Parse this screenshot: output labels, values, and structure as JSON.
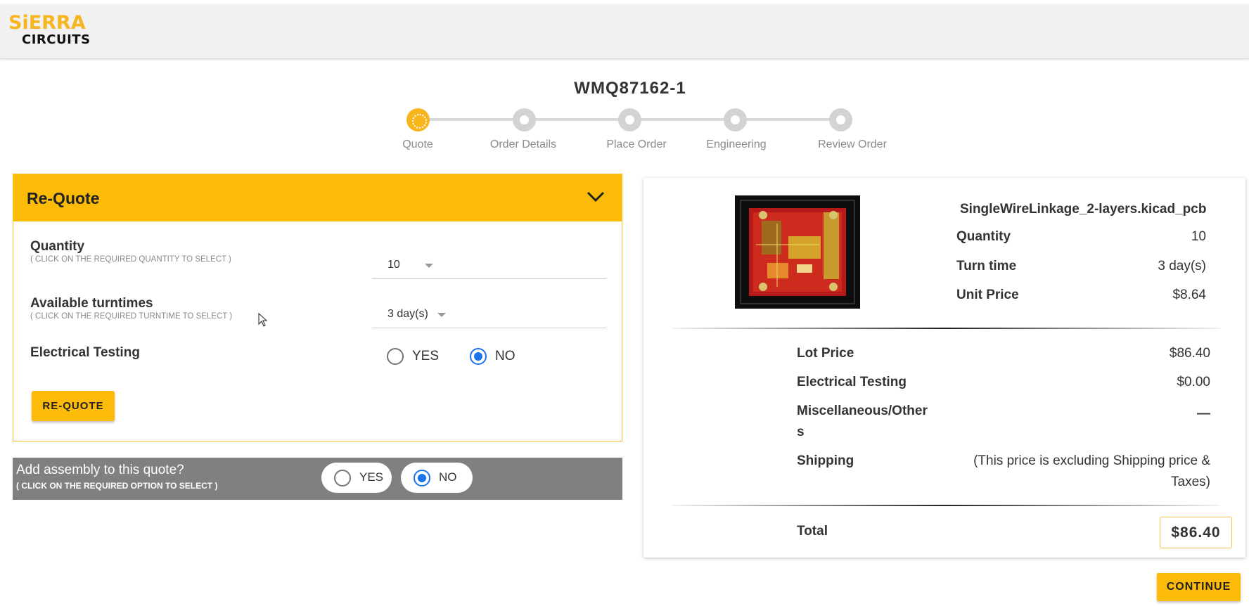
{
  "header": {
    "logo_top": "SiERRA",
    "logo_bottom": "CIRCUITS"
  },
  "order_id": "WMQ87162-1",
  "steps": [
    {
      "label": "Quote",
      "active": true
    },
    {
      "label": "Order Details",
      "active": false
    },
    {
      "label": "Place Order",
      "active": false
    },
    {
      "label": "Engineering",
      "active": false
    },
    {
      "label": "Review Order",
      "active": false
    }
  ],
  "requote": {
    "title": "Re-Quote",
    "quantity_label": "Quantity",
    "quantity_hint": "( CLICK ON THE REQUIRED QUANTITY TO SELECT )",
    "quantity_value": "10",
    "turntime_label": "Available turntimes",
    "turntime_hint": "( CLICK ON THE REQUIRED TURNTIME TO SELECT )",
    "turntime_value": "3 day(s)",
    "etest_label": "Electrical Testing",
    "etest_yes": "YES",
    "etest_no": "NO",
    "etest_selected": "NO",
    "button_label": "RE-QUOTE"
  },
  "assembly": {
    "question": "Add assembly to this quote?",
    "hint": "( CLICK ON THE REQUIRED OPTION TO SELECT )",
    "yes": "YES",
    "no": "NO",
    "selected": "NO"
  },
  "summary": {
    "filename": "SingleWireLinkage_2-layers.kicad_pcb",
    "quantity_label": "Quantity",
    "quantity_value": "10",
    "turn_label": "Turn time",
    "turn_value": "3 day(s)",
    "unit_label": "Unit Price",
    "unit_value": "$8.64",
    "lot_label": "Lot Price",
    "lot_value": "$86.40",
    "etest_label": "Electrical Testing",
    "etest_value": "$0.00",
    "misc_label_1": "Miscellaneous/Other",
    "misc_label_2": "s",
    "misc_value": "—",
    "shipping_label": "Shipping",
    "shipping_note_1": "(This price is excluding Shipping price &",
    "shipping_note_2": "Taxes)",
    "total_label": "Total",
    "total_value": "$86.40"
  },
  "continue_label": "CONTINUE",
  "colors": {
    "accent": "#fcbb08",
    "radio_checked": "#1a73e8",
    "assembly_bar": "#808080"
  }
}
